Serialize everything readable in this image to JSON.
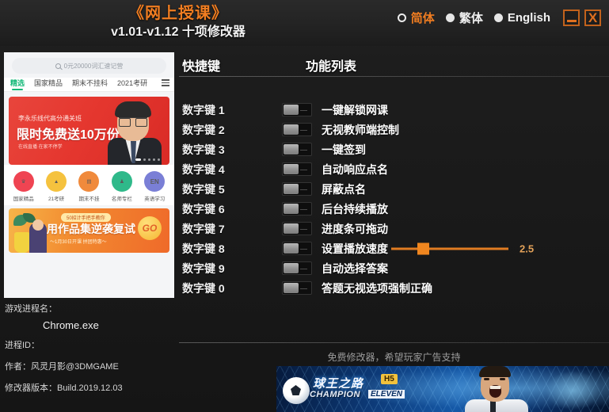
{
  "titlebar": {
    "title_main": "《网上授课》",
    "title_sub": "v1.01-v1.12 十项修改器",
    "languages": [
      {
        "label": "简体",
        "selected": true
      },
      {
        "label": "繁体",
        "selected": false
      },
      {
        "label": "English",
        "selected": false
      }
    ],
    "minimize_label": "",
    "close_label": "X",
    "accent_color": "#f07d21"
  },
  "phone_app": {
    "search_placeholder": "0元20000词汇速记营",
    "tabs": [
      {
        "label": "精选",
        "active": true
      },
      {
        "label": "国家精品",
        "active": false
      },
      {
        "label": "期末不挂科",
        "active": false
      },
      {
        "label": "2021考研",
        "active": false
      }
    ],
    "promo_red": {
      "line1": "李永乐线代高分通关班",
      "line2": "限时免费送10万份",
      "line3": "在线直播 在家不停学"
    },
    "icons": [
      {
        "label": "国家精品",
        "glyph": "♛",
        "color": "#ef4452"
      },
      {
        "label": "21考研",
        "glyph": "🎓",
        "color": "#f5c23e"
      },
      {
        "label": "期末不挂",
        "glyph": "📝",
        "color": "#f08a3c"
      },
      {
        "label": "名师专栏",
        "glyph": "🏆",
        "color": "#2fb98a"
      },
      {
        "label": "英语学习",
        "glyph": "EN",
        "color": "#7a7fd6"
      }
    ],
    "promo_orange": {
      "pill": "50招计手把手教你",
      "main": "用作品集逆袭复试",
      "sub": "～1月30日开课  拼团特惠～",
      "go": "GO"
    }
  },
  "info": {
    "process_name_label": "游戏进程名：",
    "process_name_value": "Chrome.exe",
    "process_id_label": "进程ID：",
    "author_label": "作者：风灵月影@3DMGAME",
    "version_label": "修改器版本：Build.2019.12.03"
  },
  "table": {
    "header_hotkey": "快捷键",
    "header_function": "功能列表",
    "rows": [
      {
        "hotkey": "数字键 1",
        "function": "一键解锁网课",
        "enabled": false
      },
      {
        "hotkey": "数字键 2",
        "function": "无视教师端控制",
        "enabled": false
      },
      {
        "hotkey": "数字键 3",
        "function": "一键签到",
        "enabled": false
      },
      {
        "hotkey": "数字键 4",
        "function": "自动响应点名",
        "enabled": false
      },
      {
        "hotkey": "数字键 5",
        "function": "屏蔽点名",
        "enabled": false
      },
      {
        "hotkey": "数字键 6",
        "function": "后台持续播放",
        "enabled": false
      },
      {
        "hotkey": "数字键 7",
        "function": "进度条可拖动",
        "enabled": false
      },
      {
        "hotkey": "数字键 8",
        "function": "设置播放速度",
        "enabled": false,
        "slider_value": "2.5"
      },
      {
        "hotkey": "数字键 9",
        "function": "自动选择答案",
        "enabled": false
      },
      {
        "hotkey": "数字键 0",
        "function": "答题无视选项强制正确",
        "enabled": false
      }
    ]
  },
  "ad": {
    "note": "免费修改器，希望玩家广告支持",
    "banner_title_cn": "球王之路",
    "banner_badge": "H5",
    "banner_title_en": "CHAMPION",
    "banner_title_en2": "ELEVEN"
  }
}
